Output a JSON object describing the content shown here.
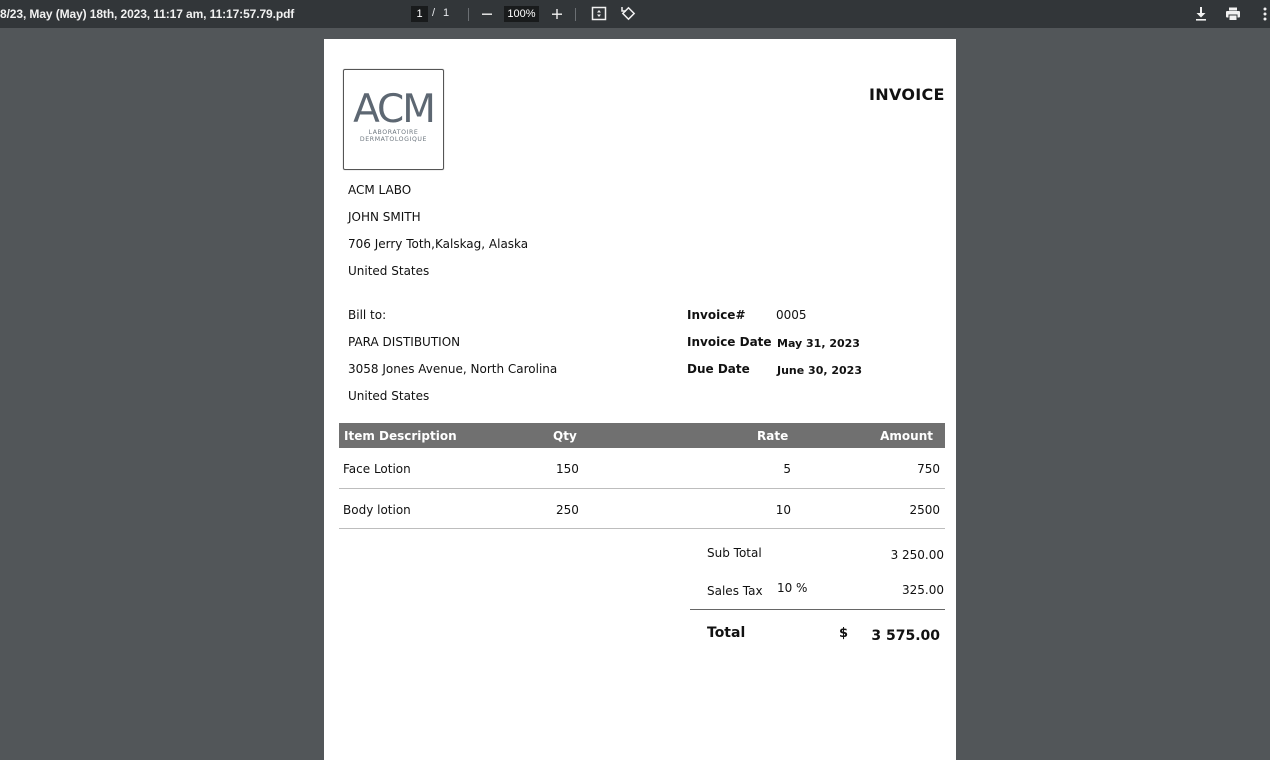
{
  "toolbar": {
    "title": "8/23, May (May) 18th, 2023, 11:17 am, 11:17:57.79.pdf",
    "current_page": "1",
    "page_separator": "/",
    "total_pages": "1",
    "zoom": "100%"
  },
  "invoice": {
    "heading": "INVOICE",
    "logo": {
      "main": "ACM",
      "line1": "LABORATOIRE",
      "line2": "DERMATOLOGIQUE"
    },
    "from": [
      "ACM LABO",
      "JOHN SMITH",
      "706 Jerry Toth,Kalskag, Alaska",
      "United States"
    ],
    "bill_to": {
      "label": "Bill to:",
      "lines": [
        "PARA DISTIBUTION",
        "3058 Jones Avenue, North Carolina",
        "United States"
      ]
    },
    "meta": {
      "invoice_no_label": "Invoice#",
      "invoice_no": "0005",
      "invoice_date_label": "Invoice Date",
      "invoice_date": "May 31, 2023",
      "due_date_label": "Due Date",
      "due_date": "June 30, 2023"
    },
    "table": {
      "headers": {
        "description": "Item Description",
        "qty": "Qty",
        "rate": "Rate",
        "amount": "Amount"
      },
      "rows": [
        {
          "description": "Face Lotion",
          "qty": "150",
          "rate": "5",
          "amount": "750"
        },
        {
          "description": "Body lotion",
          "qty": "250",
          "rate": "10",
          "amount": "2500"
        }
      ]
    },
    "totals": {
      "subtotal_label": "Sub Total",
      "subtotal": "3 250.00",
      "tax_label": "Sales Tax",
      "tax_rate": "10",
      "tax_percent": "%",
      "tax_amount": "325.00",
      "total_label": "Total",
      "currency": "$",
      "total": "3 575.00"
    }
  },
  "icons": {
    "zoom_out": "minus-icon",
    "zoom_in": "plus-icon",
    "fit": "fit-page-icon",
    "rotate": "rotate-icon",
    "download": "download-icon",
    "print": "print-icon",
    "more": "more-vertical-icon"
  }
}
